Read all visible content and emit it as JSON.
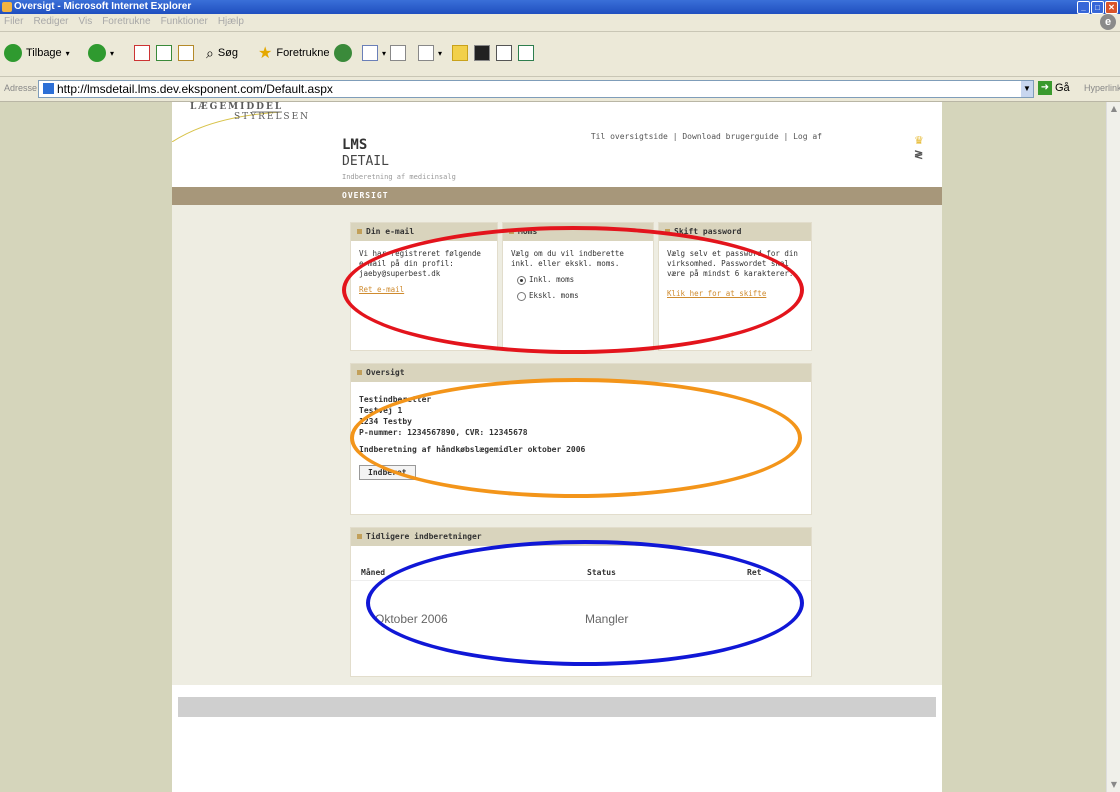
{
  "window": {
    "title": "Oversigt - Microsoft Internet Explorer"
  },
  "menubar": {
    "items": [
      "Filer",
      "Rediger",
      "Vis",
      "Foretrukne",
      "Funktioner",
      "Hjælp"
    ]
  },
  "toolbar": {
    "back": "Tilbage",
    "search": "Søg",
    "favorites": "Foretrukne"
  },
  "addressbar": {
    "label": "Adresse",
    "url": "http://lmsdetail.lms.dev.eksponent.com/Default.aspx",
    "go": "Gå",
    "links": "Hyperlinks"
  },
  "brand": {
    "line1": "LÆGEMIDDEL",
    "line2": "STYRELSEN"
  },
  "topnav": {
    "text": "Til oversigtside | Download brugerguide | Log af"
  },
  "header": {
    "title": "LMS",
    "subtitle": "DETAIL",
    "tagline": "Indberetning af medicinsalg"
  },
  "nav": {
    "current": "OVERSIGT"
  },
  "email_box": {
    "heading": "Din e-mail",
    "text": "Vi har registreret følgende e-mail på din profil:",
    "email": "jaeby@superbest.dk",
    "link": "Ret e-mail"
  },
  "moms_box": {
    "heading": "Moms",
    "text": "Vælg om du vil indberette inkl. eller ekskl. moms.",
    "option_incl": "Inkl. moms",
    "option_excl": "Ekskl. moms",
    "selected": "Inkl. moms"
  },
  "password_box": {
    "heading": "Skift password",
    "text": "Vælg selv et password for din virksomhed. Passwordet skal være på mindst 6 karakterer.",
    "link": "Klik her for at skifte"
  },
  "overview_box": {
    "heading": "Oversigt",
    "name": "Testindberetter",
    "street": "Testvej 1",
    "city": "1234 Testby",
    "numbers": "P-nummer: 1234567890, CVR: 12345678",
    "report": "Indberetning af håndkøbslægemidler oktober 2006",
    "button": "Indberet"
  },
  "history_box": {
    "heading": "Tidligere indberetninger",
    "columns": [
      "Måned",
      "Status",
      "Ret"
    ],
    "rows": [
      {
        "month": "Oktober 2006",
        "status": "Mangler"
      }
    ]
  },
  "colors": {
    "red_marker": "#e3141c",
    "orange_marker": "#f3951a",
    "blue_marker": "#1017d6"
  }
}
